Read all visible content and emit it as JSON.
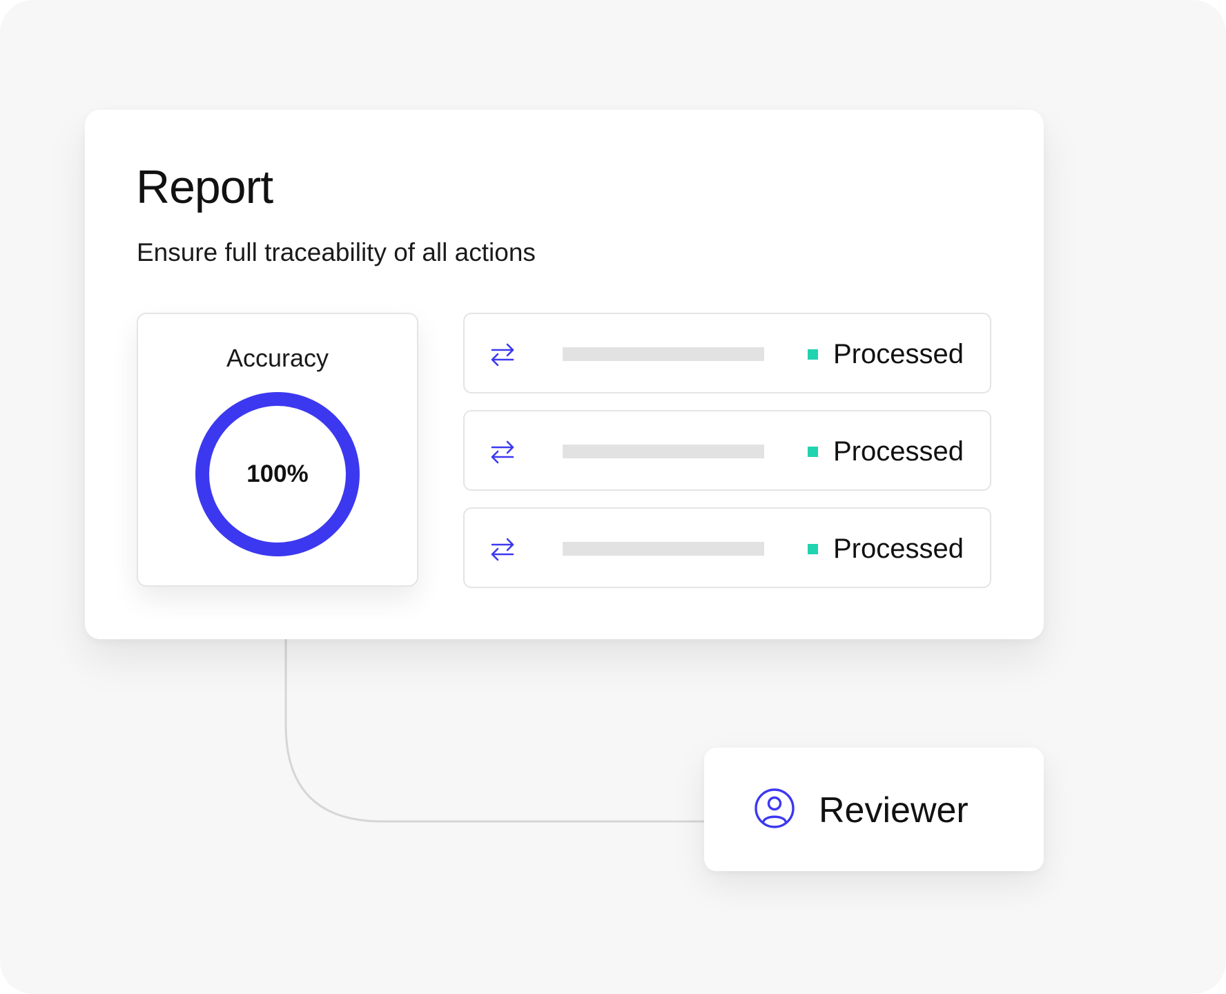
{
  "colors": {
    "accent": "#3c38f0",
    "status_green": "#22d3b0",
    "placeholder_bar": "#e2e2e2",
    "border": "#e4e4e4",
    "background": "#f7f7f7"
  },
  "report": {
    "title": "Report",
    "subtitle": "Ensure full traceability of all actions",
    "accuracy": {
      "label": "Accuracy",
      "value_text": "100%",
      "progress": 1.0
    },
    "rows": [
      {
        "icon": "swap-arrows-icon",
        "status": "Processed"
      },
      {
        "icon": "swap-arrows-icon",
        "status": "Processed"
      },
      {
        "icon": "swap-arrows-icon",
        "status": "Processed"
      }
    ]
  },
  "reviewer": {
    "icon": "user-circle-icon",
    "label": "Reviewer"
  }
}
